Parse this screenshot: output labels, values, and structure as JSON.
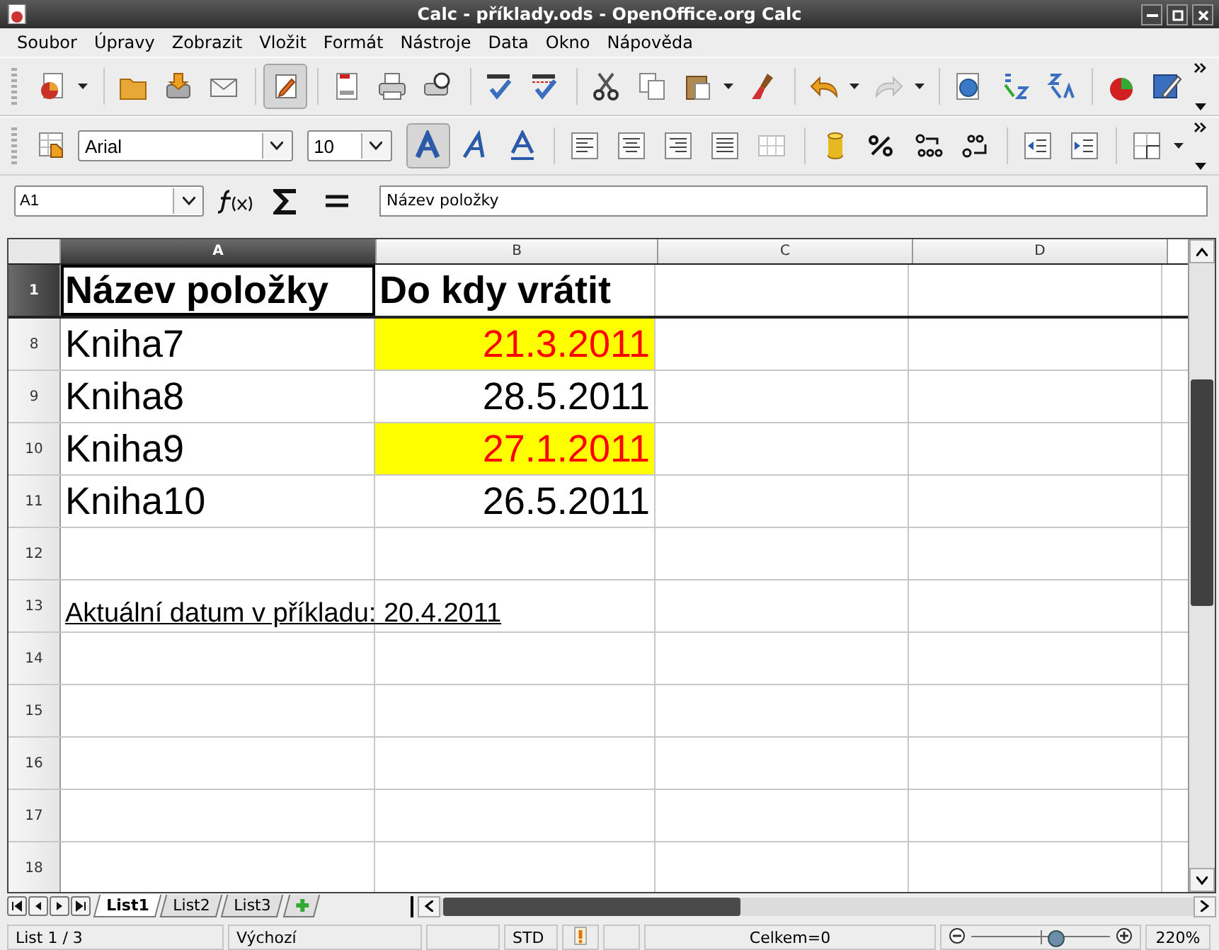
{
  "window": {
    "title": "Calc - příklady.ods - OpenOffice.org Calc"
  },
  "menu": [
    "Soubor",
    "Úpravy",
    "Zobrazit",
    "Vložit",
    "Formát",
    "Nástroje",
    "Data",
    "Okno",
    "Nápověda"
  ],
  "format_bar": {
    "font_name": "Arial",
    "font_size": "10"
  },
  "formula_bar": {
    "name_box": "A1",
    "formula": "Název položky"
  },
  "columns": [
    {
      "label": "A",
      "selected": true
    },
    {
      "label": "B",
      "selected": false
    },
    {
      "label": "C",
      "selected": false
    },
    {
      "label": "D",
      "selected": false
    }
  ],
  "rows": [
    {
      "number": "1",
      "selected": true,
      "cells": [
        {
          "kind": "header",
          "text": "Název položky"
        },
        {
          "kind": "header",
          "text": "Do kdy vrátit"
        }
      ]
    },
    {
      "number": "8",
      "selected": false,
      "cells": [
        {
          "kind": "text",
          "text": "Kniha7"
        },
        {
          "kind": "date",
          "text": "21.3.2011",
          "highlighted": true
        }
      ]
    },
    {
      "number": "9",
      "selected": false,
      "cells": [
        {
          "kind": "text",
          "text": "Kniha8"
        },
        {
          "kind": "date",
          "text": "28.5.2011",
          "highlighted": false
        }
      ]
    },
    {
      "number": "10",
      "selected": false,
      "cells": [
        {
          "kind": "text",
          "text": "Kniha9"
        },
        {
          "kind": "date",
          "text": "27.1.2011",
          "highlighted": true
        }
      ]
    },
    {
      "number": "11",
      "selected": false,
      "cells": [
        {
          "kind": "text",
          "text": "Kniha10"
        },
        {
          "kind": "date",
          "text": "26.5.2011",
          "highlighted": false
        }
      ]
    },
    {
      "number": "12",
      "selected": false,
      "cells": []
    },
    {
      "number": "13",
      "selected": false,
      "cells": [
        {
          "kind": "note",
          "text": "Aktuální datum v příkladu: 20.4.2011 "
        }
      ]
    },
    {
      "number": "14",
      "selected": false,
      "cells": []
    },
    {
      "number": "15",
      "selected": false,
      "cells": []
    },
    {
      "number": "16",
      "selected": false,
      "cells": []
    },
    {
      "number": "17",
      "selected": false,
      "cells": []
    },
    {
      "number": "18",
      "selected": false,
      "cells": []
    }
  ],
  "sheet_tabs": [
    {
      "label": "List1",
      "selected": true
    },
    {
      "label": "List2",
      "selected": false
    },
    {
      "label": "List3",
      "selected": false
    }
  ],
  "status_bar": {
    "sheet": "List 1 / 3",
    "page_style": "Výchozí",
    "mode": "STD",
    "sum": "Celkem=0",
    "zoom_slider": {
      "level": 0.6
    },
    "zoom": "220%"
  }
}
